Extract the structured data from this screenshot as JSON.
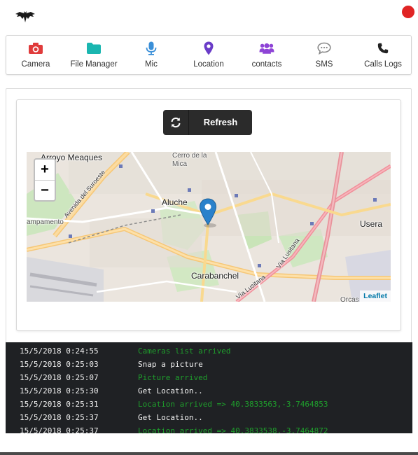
{
  "header": {
    "logo_icon": "bat-logo-icon",
    "status_color": "#e02424"
  },
  "toolbar": {
    "items": [
      {
        "label": "Camera",
        "icon": "camera-icon",
        "color": "#e03b3b"
      },
      {
        "label": "File Manager",
        "icon": "folder-icon",
        "color": "#1ab6b0"
      },
      {
        "label": "Mic",
        "icon": "microphone-icon",
        "color": "#3a8fd8"
      },
      {
        "label": "Location",
        "icon": "map-marker-icon",
        "color": "#6a3cc8"
      },
      {
        "label": "contacts",
        "icon": "users-icon",
        "color": "#8e44d6"
      },
      {
        "label": "SMS",
        "icon": "comment-icon",
        "color": "#888888"
      },
      {
        "label": "Calls Logs",
        "icon": "phone-icon",
        "color": "#222222"
      }
    ]
  },
  "location": {
    "refresh_label": "Refresh",
    "map": {
      "labels": [
        "Arroyo Meaques",
        "Cerro de la Mica",
        "Aluche",
        "ampamento",
        "Usera",
        "Carabanchel",
        "Avenida del Suroeste",
        "Vía Lusitana",
        "Vía Lusitana",
        "Orcas"
      ],
      "zoom_in": "+",
      "zoom_out": "−",
      "attribution": "Leaflet"
    }
  },
  "console": {
    "entries": [
      {
        "time": "15/5/2018 0:24:55",
        "message": "Cameras list arrived",
        "status": "ok"
      },
      {
        "time": "15/5/2018 0:25:03",
        "message": "Snap a picture",
        "status": "info"
      },
      {
        "time": "15/5/2018 0:25:07",
        "message": "Picture arrived",
        "status": "ok"
      },
      {
        "time": "15/5/2018 0:25:30",
        "message": "Get Location..",
        "status": "info"
      },
      {
        "time": "15/5/2018 0:25:31",
        "message": "Location arrived => 40.3833563,-3.7464853",
        "status": "ok"
      },
      {
        "time": "15/5/2018 0:25:37",
        "message": "Get Location..",
        "status": "info"
      },
      {
        "time": "15/5/2018 0:25:37",
        "message": "Location arrived => 40.3833538,-3.7464872",
        "status": "ok"
      }
    ]
  }
}
